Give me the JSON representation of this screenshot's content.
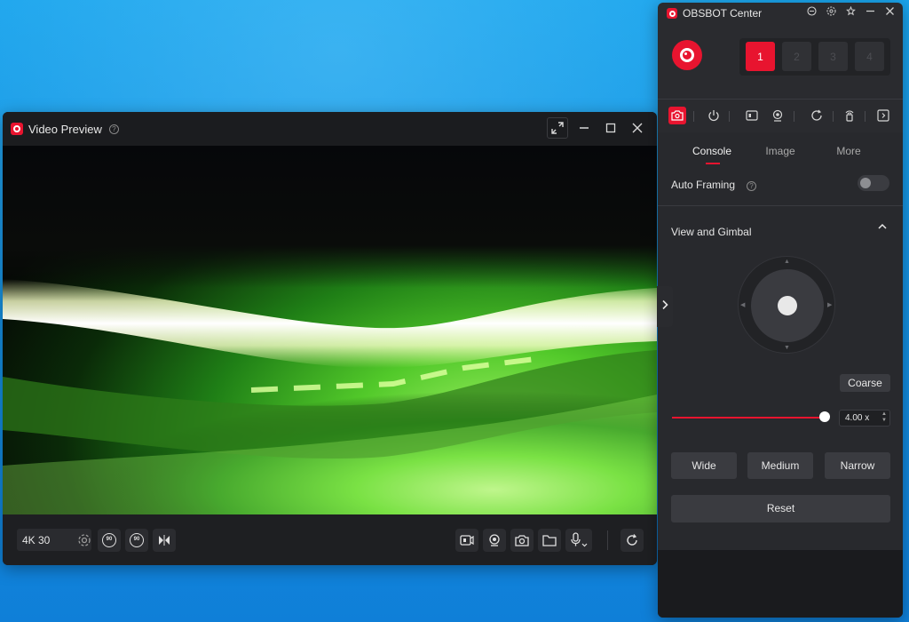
{
  "video_preview": {
    "title": "Video Preview",
    "help_glyph": "?",
    "resolution": "4K 30",
    "toolbar_icons": [
      "settings-icon",
      "rotate-left-90-icon",
      "rotate-right-90-icon",
      "flip-icon",
      "record-icon",
      "virtual-camera-icon",
      "snapshot-icon",
      "folder-icon",
      "microphone-icon",
      "refresh-icon"
    ],
    "rotate_left_label": "90",
    "rotate_right_label": "90"
  },
  "obsbot": {
    "title": "OBSBOT Center",
    "slots": [
      "1",
      "2",
      "3",
      "4"
    ],
    "active_slot": "1",
    "tabs": [
      "Console",
      "Image",
      "More"
    ],
    "active_tab": "Console",
    "auto_framing": {
      "label": "Auto Framing",
      "enabled": false
    },
    "section": {
      "title": "View and Gimbal"
    },
    "coarse_label": "Coarse",
    "zoom": {
      "value": "4.00 x",
      "fraction": 1.0
    },
    "presets": [
      "Wide",
      "Medium",
      "Narrow"
    ],
    "reset_label": "Reset"
  },
  "colors": {
    "accent": "#e8142f",
    "window_bg": "#1e1f22",
    "panel_bg": "#2a2b2f",
    "desktop": "#1693e2"
  }
}
